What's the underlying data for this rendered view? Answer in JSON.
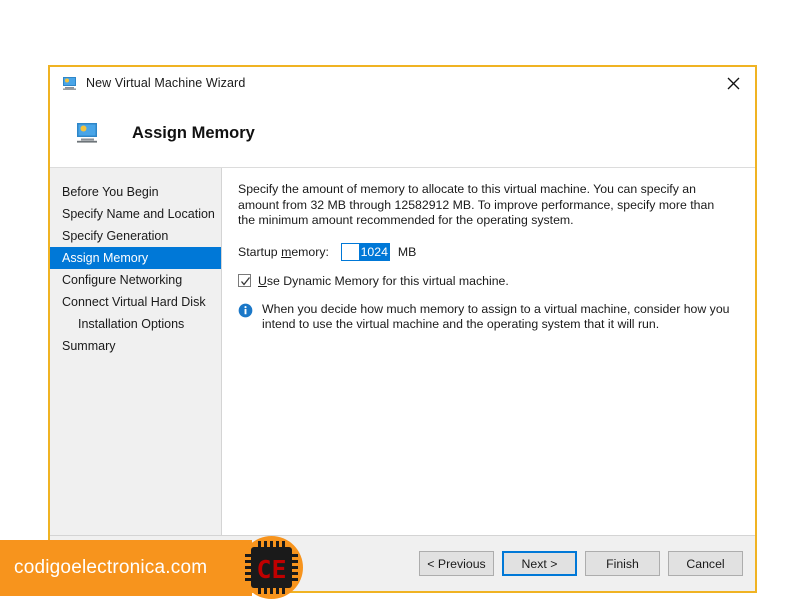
{
  "window": {
    "title": "New Virtual Machine Wizard",
    "title_icon": "virtual-machine-icon",
    "close_icon": "close-icon",
    "border_color": "#f0b323"
  },
  "header": {
    "icon": "virtual-machine-icon",
    "title": "Assign Memory"
  },
  "sidebar": {
    "selected_color": "#0078d7",
    "items": [
      {
        "label": "Before You Begin",
        "selected": false,
        "indent": false
      },
      {
        "label": "Specify Name and Location",
        "selected": false,
        "indent": false
      },
      {
        "label": "Specify Generation",
        "selected": false,
        "indent": false
      },
      {
        "label": "Assign Memory",
        "selected": true,
        "indent": false
      },
      {
        "label": "Configure Networking",
        "selected": false,
        "indent": false
      },
      {
        "label": "Connect Virtual Hard Disk",
        "selected": false,
        "indent": false
      },
      {
        "label": "Installation Options",
        "selected": false,
        "indent": true
      },
      {
        "label": "Summary",
        "selected": false,
        "indent": false
      }
    ]
  },
  "content": {
    "intro": "Specify the amount of memory to allocate to this virtual machine. You can specify an amount from 32 MB through 12582912 MB. To improve performance, specify more than the minimum amount recommended for the operating system.",
    "memory_label_prefix": "Startup ",
    "memory_label_accesskey": "m",
    "memory_label_suffix": "emory:",
    "startup_memory_value": "1024",
    "startup_memory_placeholder": "1024",
    "memory_unit": "MB",
    "dynamic_memory": {
      "checked": true,
      "check_icon": "checkmark-icon",
      "label_accesskey": "U",
      "label_rest": "se Dynamic Memory for this virtual machine."
    },
    "info": {
      "icon": "info-icon",
      "text": "When you decide how much memory to assign to a virtual machine, consider how you intend to use the virtual machine and the operating system that it will run."
    }
  },
  "footer": {
    "buttons": [
      {
        "label": "< Previous",
        "default": false,
        "name": "previous-button"
      },
      {
        "label": "Next >",
        "default": true,
        "name": "next-button"
      },
      {
        "label": "Finish",
        "default": false,
        "name": "finish-button"
      },
      {
        "label": "Cancel",
        "default": false,
        "name": "cancel-button"
      }
    ]
  },
  "watermark": {
    "text": "codigoelectronica.com",
    "background_color": "#f7941d",
    "logo_letters": "CE",
    "logo_letters_color": "#c00000"
  }
}
